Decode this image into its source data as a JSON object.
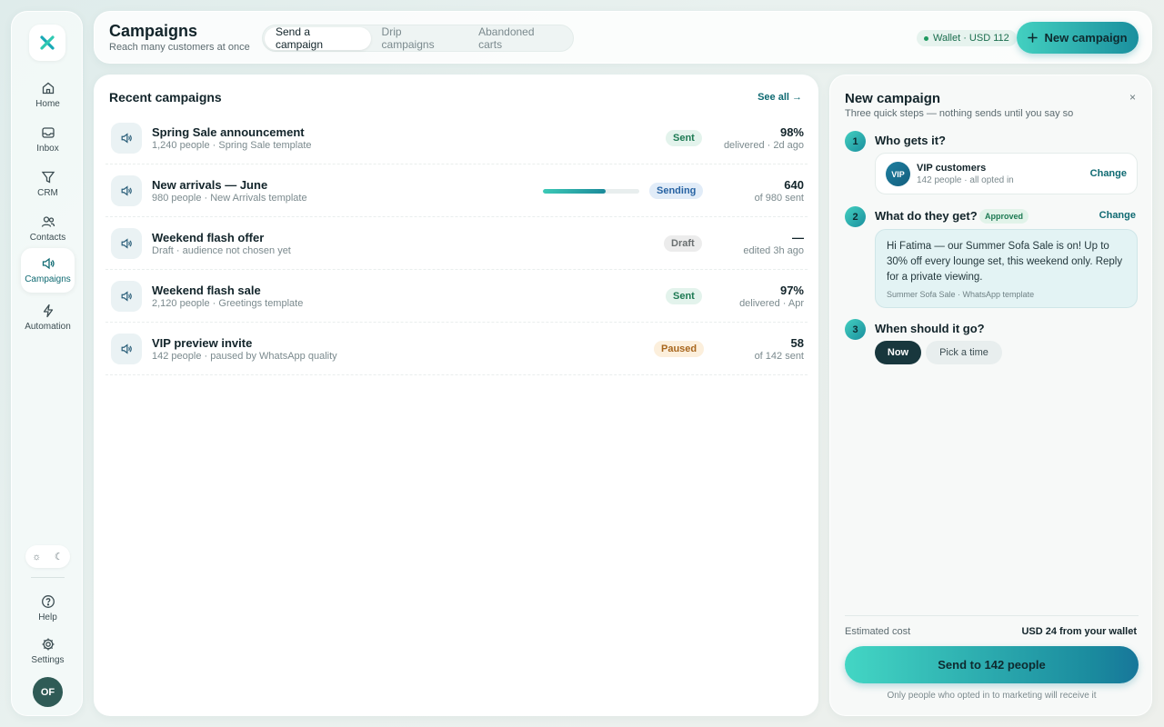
{
  "sidebar": {
    "items": [
      {
        "label": "Home",
        "icon": "home-icon"
      },
      {
        "label": "Inbox",
        "icon": "inbox-icon"
      },
      {
        "label": "CRM",
        "icon": "funnel-icon"
      },
      {
        "label": "Contacts",
        "icon": "contacts-icon"
      },
      {
        "label": "Campaigns",
        "icon": "megaphone-icon",
        "active": true
      },
      {
        "label": "Automation",
        "icon": "bolt-icon"
      }
    ],
    "help_label": "Help",
    "settings_label": "Settings",
    "avatar_initials": "OF"
  },
  "header": {
    "title": "Campaigns",
    "subtitle": "Reach many customers at once",
    "tabs": [
      {
        "label": "Send a campaign",
        "active": true
      },
      {
        "label": "Drip campaigns"
      },
      {
        "label": "Abandoned carts"
      }
    ],
    "wallet": "Wallet · USD 112",
    "new_campaign_label": "New campaign"
  },
  "recent": {
    "title": "Recent campaigns",
    "see_all": "See all →",
    "rows": [
      {
        "name": "Spring Sale announcement",
        "sub": "1,240 people · Spring Sale template",
        "status": "Sent",
        "stat": "98%",
        "stat_sub": "delivered · 2d ago"
      },
      {
        "name": "New arrivals — June",
        "sub": "980 people · New Arrivals template",
        "status": "Sending",
        "stat": "640",
        "stat_sub": "of 980 sent",
        "progress": 0.65
      },
      {
        "name": "Weekend flash offer",
        "sub": "Draft · audience not chosen yet",
        "status": "Draft",
        "stat": "—",
        "stat_sub": "edited 3h ago"
      },
      {
        "name": "Weekend flash sale",
        "sub": "2,120 people · Greetings template",
        "status": "Sent",
        "stat": "97%",
        "stat_sub": "delivered · Apr"
      },
      {
        "name": "VIP preview invite",
        "sub": "142 people · paused by WhatsApp quality",
        "status": "Paused",
        "stat": "58",
        "stat_sub": "of 142 sent"
      }
    ]
  },
  "new_campaign": {
    "title": "New campaign",
    "subtitle": "Three quick steps — nothing sends until you say so",
    "close": "×",
    "step1": {
      "num": "1",
      "question": "Who gets it?",
      "avatar": "VIP",
      "audience": "VIP customers",
      "audience_sub": "142 people · all opted in",
      "change": "Change"
    },
    "step2": {
      "num": "2",
      "question": "What do they get?",
      "badge": "Approved",
      "change": "Change",
      "message": "Hi Fatima — our Summer Sofa Sale is on! Up to 30% off every lounge set, this weekend only. Reply for a private viewing.",
      "meta": "Summer Sofa Sale · WhatsApp template"
    },
    "step3": {
      "num": "3",
      "question": "When should it go?",
      "now": "Now",
      "pick": "Pick a time"
    },
    "cost_label": "Estimated cost",
    "cost_value": "USD 24 from your wallet",
    "send_label": "Send to 142 people",
    "note": "Only people who opted in to marketing will receive it"
  },
  "colors": {
    "accent": "#1a8f9e",
    "accent_light": "#43d0c0",
    "dark": "#18373d"
  }
}
